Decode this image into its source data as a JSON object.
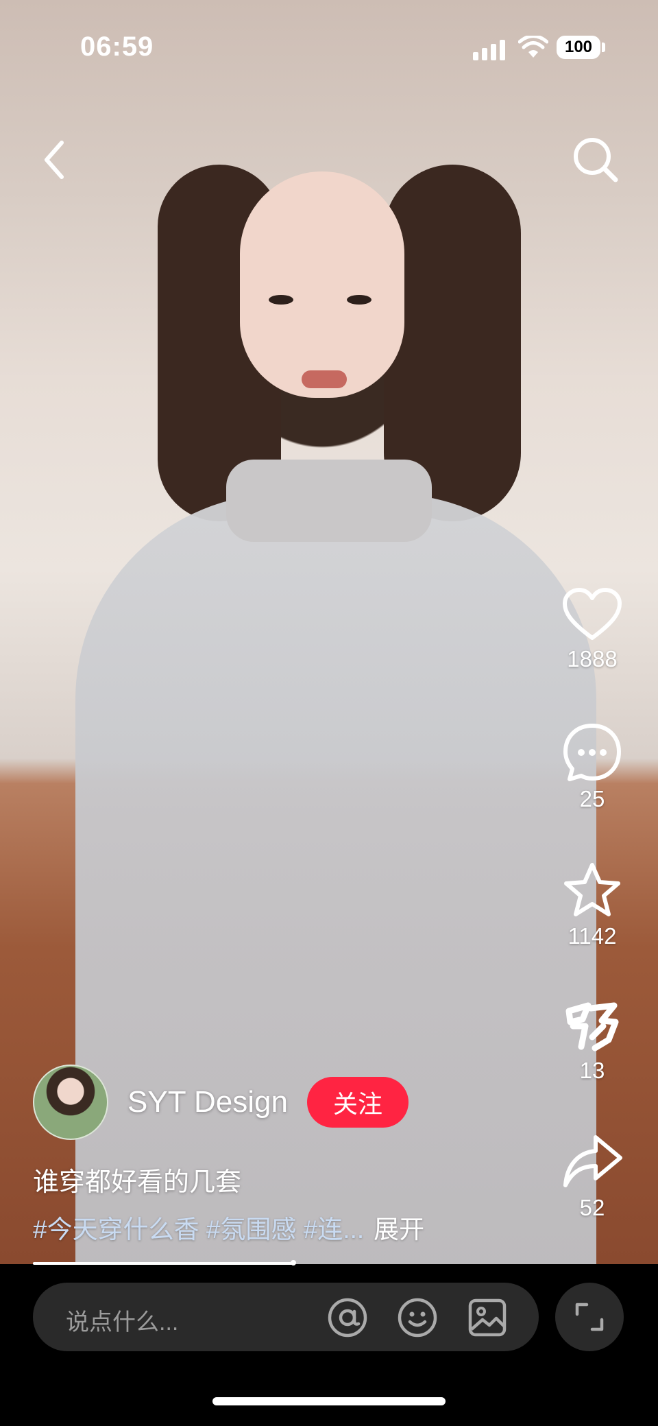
{
  "status_bar": {
    "time": "06:59",
    "battery": "100"
  },
  "actions": {
    "like_count": "1888",
    "comment_count": "25",
    "favorite_count": "1142",
    "good_count": "13",
    "share_count": "52"
  },
  "author": {
    "name": "SYT Design",
    "follow_label": "关注"
  },
  "post": {
    "caption": "谁穿都好看的几套",
    "tags": "#今天穿什么香 #氛围感 #连...",
    "expand_label": "展开"
  },
  "comment": {
    "placeholder": "说点什么..."
  },
  "colors": {
    "follow": "#ff2442",
    "tag": "#c9dbf2",
    "input_bg": "#2a2a2a"
  },
  "icons": [
    "back-icon",
    "search-icon",
    "heart-icon",
    "comment-icon",
    "star-icon",
    "good-icon",
    "share-icon",
    "at-icon",
    "emoji-icon",
    "image-icon",
    "expand-icon"
  ]
}
